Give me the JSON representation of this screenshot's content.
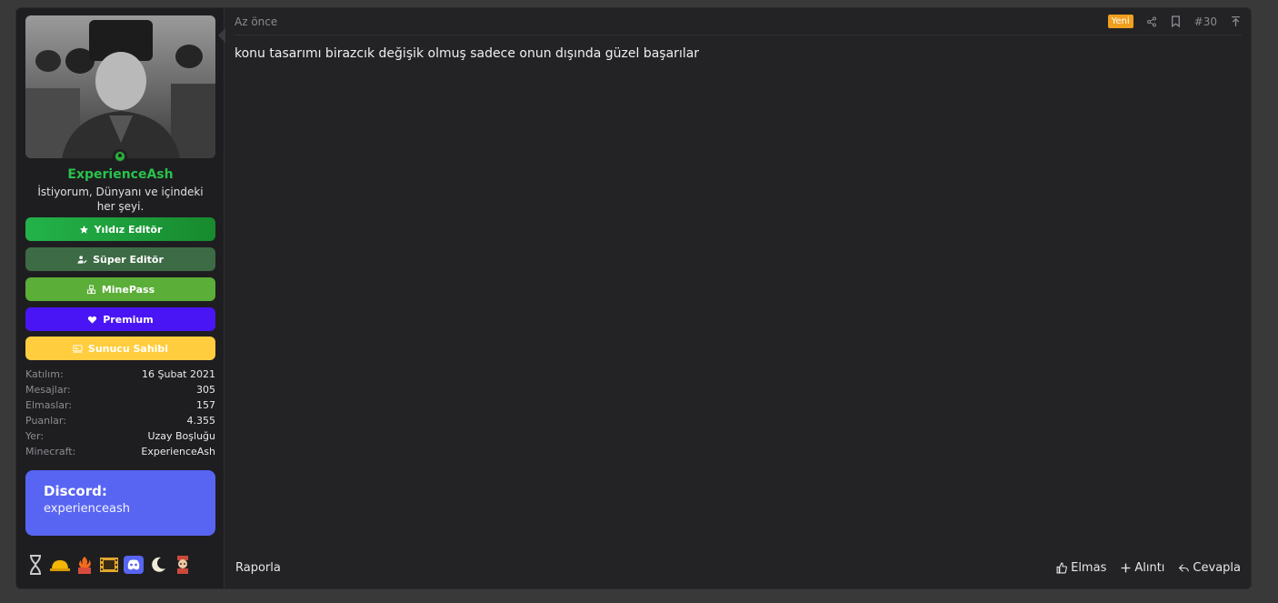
{
  "user": {
    "name": "ExperienceAsh",
    "title": "İstiyorum, Dünyanı ve içindeki her şeyi.",
    "badges": [
      {
        "label": "Yıldız Editör",
        "icon": "star-icon"
      },
      {
        "label": "Süper Editör",
        "icon": "user-edit-icon"
      },
      {
        "label": "MinePass",
        "icon": "cubes-icon"
      },
      {
        "label": "Premium",
        "icon": "heart-icon"
      },
      {
        "label": "Sunucu Sahibi",
        "icon": "server-icon"
      }
    ],
    "stats": [
      {
        "key": "Katılım:",
        "value": "16 Şubat 2021"
      },
      {
        "key": "Mesajlar:",
        "value": "305"
      },
      {
        "key": "Elmaslar:",
        "value": "157"
      },
      {
        "key": "Puanlar:",
        "value": "4.355"
      },
      {
        "key": "Yer:",
        "value": "Uzay Boşluğu"
      },
      {
        "key": "Minecraft:",
        "value": "ExperienceAsh"
      }
    ],
    "discord": {
      "title": "Discord:",
      "handle": "experienceash"
    }
  },
  "post": {
    "time": "Az önce",
    "new_label": "Yeni",
    "number": "#30",
    "content": "konu tasarımı birazcık değişik olmuş sadece onun dışında güzel başarılar",
    "report_label": "Raporla",
    "buttons": {
      "diamond": "Elmas",
      "quote": "Alıntı",
      "reply": "Cevapla"
    }
  },
  "colors": {
    "username": "#29c24b",
    "new_badge": "#f0a01e",
    "discord": "#5865f2",
    "badge_yildiz": "#23b34a",
    "badge_super": "#3d6b45",
    "badge_minepass": "#5bae38",
    "badge_premium": "#4a15f5",
    "badge_sunucu": "#ffcd3e"
  }
}
